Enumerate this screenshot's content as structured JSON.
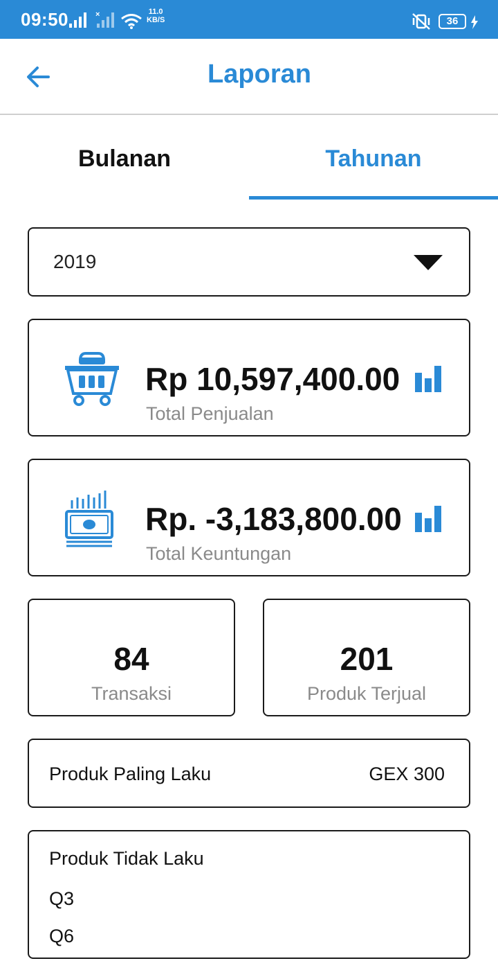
{
  "status_bar": {
    "time": "09:50",
    "net_speed_value": "11.0",
    "net_speed_unit": "KB/S",
    "battery": "36",
    "icons": [
      "signal-icon",
      "signal-no-data-icon",
      "wifi-icon",
      "vibrate-mute-icon",
      "battery-icon",
      "charging-icon"
    ]
  },
  "appbar": {
    "title": "Laporan",
    "back_icon": "arrow-left-icon"
  },
  "tabs": [
    {
      "label": "Bulanan",
      "active": false
    },
    {
      "label": "Tahunan",
      "active": true
    }
  ],
  "year_select": {
    "value": "2019"
  },
  "sales_card": {
    "amount": "Rp 10,597,400.00",
    "label": "Total Penjualan",
    "icon": "shopping-basket-icon"
  },
  "profit_card": {
    "amount": "Rp. -3,183,800.00",
    "label": "Total Keuntungan",
    "icon": "money-chart-icon"
  },
  "stats": {
    "transactions": {
      "value": "84",
      "label": "Transaksi"
    },
    "products_sold": {
      "value": "201",
      "label": "Produk Terjual"
    }
  },
  "best_seller": {
    "label": "Produk Paling Laku",
    "value": "GEX 300"
  },
  "worst_sellers": {
    "title": "Produk Tidak Laku",
    "items": [
      "Q3",
      "Q6"
    ]
  },
  "colors": {
    "accent": "#2a8ad6",
    "text": "#111111",
    "muted": "#8a8a8a",
    "border": "#1a1a1a"
  }
}
